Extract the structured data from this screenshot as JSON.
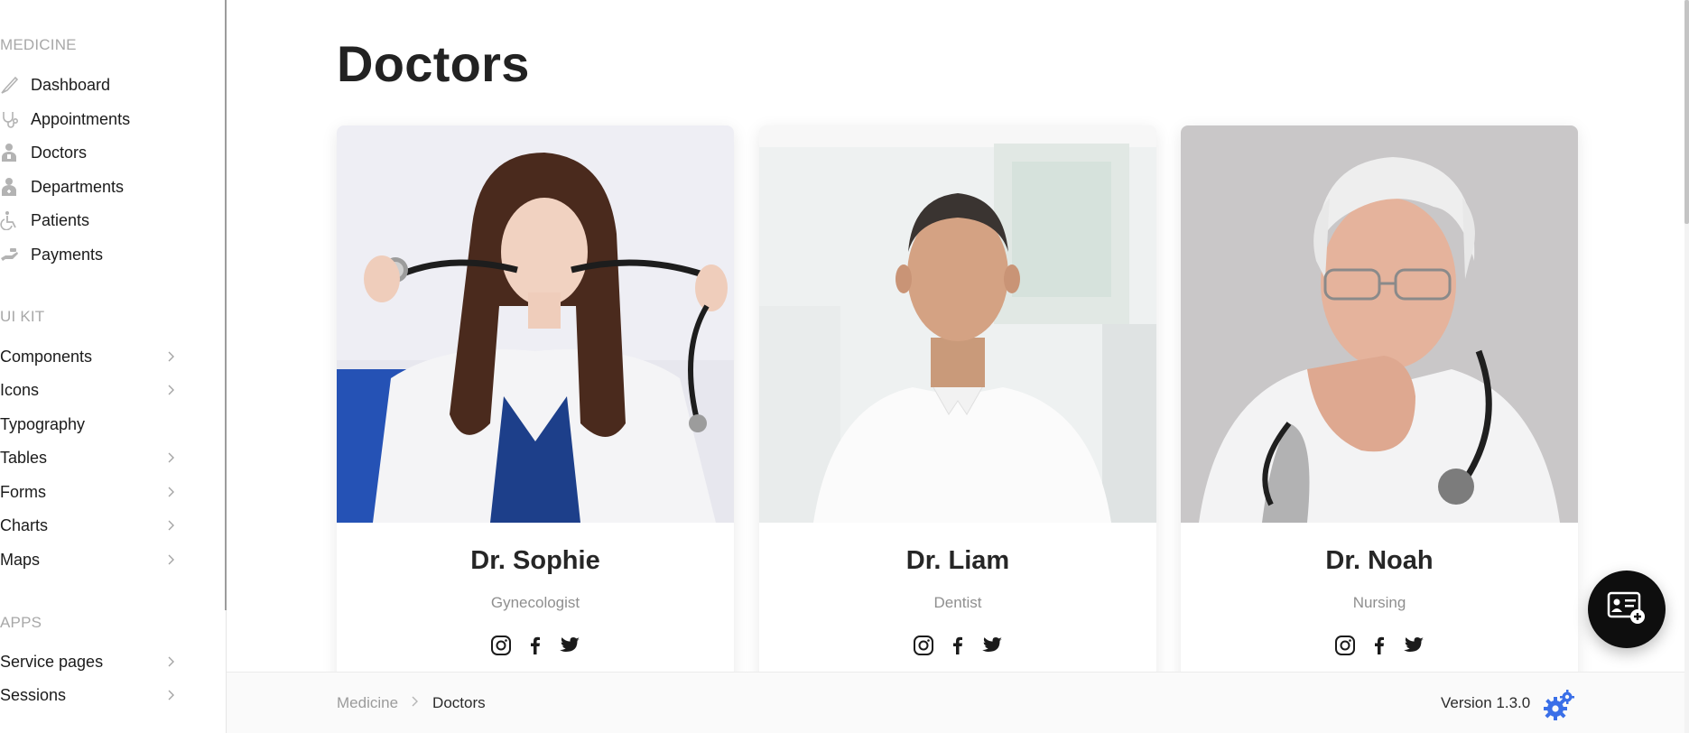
{
  "sidebar": {
    "sections": [
      {
        "title": "MEDICINE",
        "items": [
          {
            "label": "Dashboard",
            "icon": "brush-icon"
          },
          {
            "label": "Appointments",
            "icon": "stethoscope-icon"
          },
          {
            "label": "Doctors",
            "icon": "doctor-icon"
          },
          {
            "label": "Departments",
            "icon": "department-icon"
          },
          {
            "label": "Patients",
            "icon": "wheelchair-icon"
          },
          {
            "label": "Payments",
            "icon": "payment-hand-icon"
          }
        ]
      },
      {
        "title": "UI KIT",
        "items": [
          {
            "label": "Components",
            "has_children": true
          },
          {
            "label": "Icons",
            "has_children": true
          },
          {
            "label": "Typography",
            "has_children": false
          },
          {
            "label": "Tables",
            "has_children": true
          },
          {
            "label": "Forms",
            "has_children": true
          },
          {
            "label": "Charts",
            "has_children": true
          },
          {
            "label": "Maps",
            "has_children": true
          }
        ]
      },
      {
        "title": "APPS",
        "items": [
          {
            "label": "Service pages",
            "has_children": true
          },
          {
            "label": "Sessions",
            "has_children": true
          }
        ]
      }
    ]
  },
  "main": {
    "title": "Doctors",
    "doctors": [
      {
        "name": "Dr. Sophie",
        "specialty": "Gynecologist"
      },
      {
        "name": "Dr. Liam",
        "specialty": "Dentist"
      },
      {
        "name": "Dr. Noah",
        "specialty": "Nursing"
      }
    ],
    "social_icons": [
      "instagram-icon",
      "facebook-icon",
      "twitter-icon"
    ]
  },
  "footer": {
    "breadcrumb": [
      "Medicine",
      "Doctors"
    ],
    "version": "Version 1.3.0"
  },
  "fab": {
    "icon": "add-contact-card-icon"
  },
  "colors": {
    "text": "#1b1b1b",
    "muted": "#a8a8a8",
    "accent_blue": "#3a6fe8",
    "fab_bg": "#0e0e0e"
  }
}
